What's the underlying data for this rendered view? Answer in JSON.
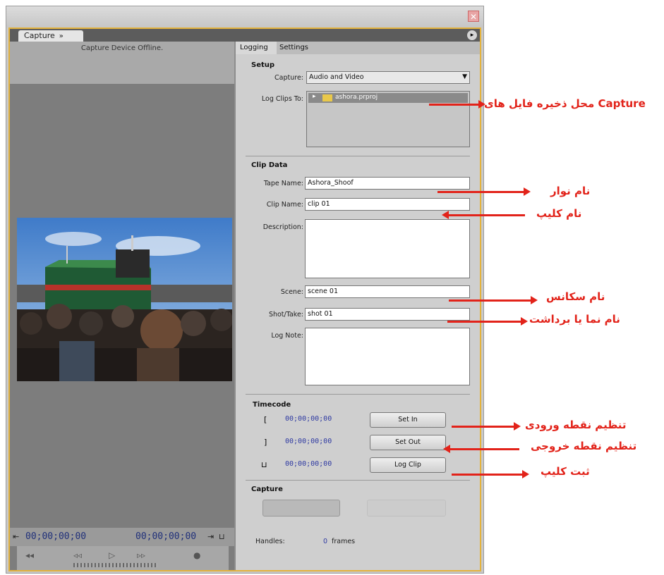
{
  "panel": {
    "tab_label": "Capture",
    "tab_close": "»"
  },
  "left": {
    "offline_text": "Capture Device Offline.",
    "tc_in": "00;00;00;00",
    "tc_out": "00;00;00;00"
  },
  "tabs": {
    "logging": "Logging",
    "settings": "Settings"
  },
  "setup": {
    "title": "Setup",
    "capture_label": "Capture:",
    "capture_value": "Audio and Video",
    "logclips_label": "Log Clips To:",
    "project_name": "ashora.prproj"
  },
  "clip_data": {
    "title": "Clip Data",
    "tape_name_label": "Tape Name:",
    "tape_name_value": "Ashora_Shoof",
    "clip_name_label": "Clip Name:",
    "clip_name_value": "clip 01",
    "description_label": "Description:",
    "scene_label": "Scene:",
    "scene_value": "scene 01",
    "shot_label": "Shot/Take:",
    "shot_value": "shot 01",
    "log_note_label": "Log Note:"
  },
  "timecode": {
    "title": "Timecode",
    "in_value": "00;00;00;00",
    "out_value": "00;00;00;00",
    "dur_value": "00;00;00;00",
    "set_in": "Set In",
    "set_out": "Set Out",
    "log_clip": "Log Clip"
  },
  "capture": {
    "title": "Capture",
    "handles_label": "Handles:",
    "frames_label": "frames",
    "handles_value": "0"
  },
  "annotations": {
    "capture_location": "محل ذخیره فایل های Capture",
    "tape_name": "نام نوار",
    "clip_name": "نام کلیپ",
    "scene_name": "نام سکانس",
    "shot_name": "نام نما یا برداشت",
    "set_in": "تنظیم نقطه ورودی",
    "set_out": "تنظیم نقطه خروجی",
    "log_clip": "ثبت کلیپ"
  },
  "colors": {
    "annotation": "#e2231a",
    "panel_border": "#e3b23c",
    "timecode_text": "#2f3aa2"
  }
}
